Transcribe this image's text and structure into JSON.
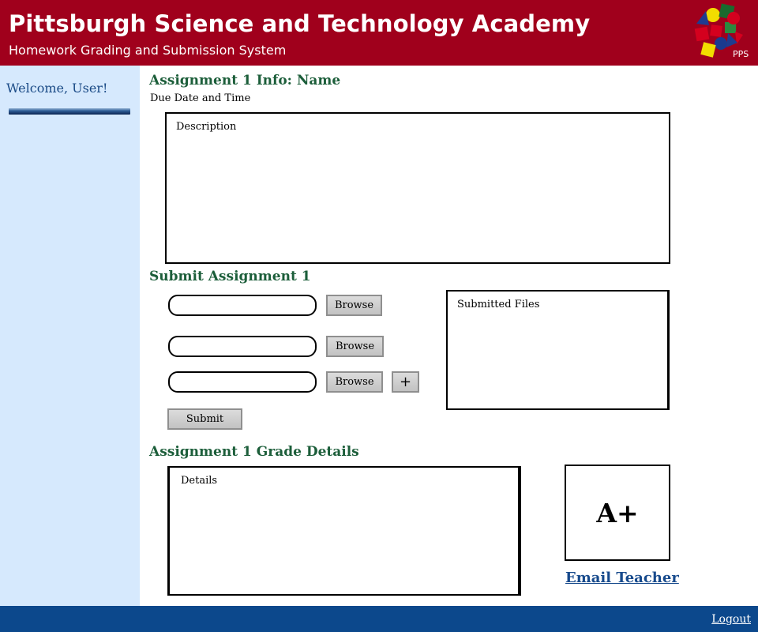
{
  "header": {
    "title": "Pittsburgh Science and Technology Academy",
    "subtitle": "Homework Grading and Submission System",
    "logo_text": "PPS"
  },
  "sidebar": {
    "welcome": "Welcome, User!"
  },
  "assignment_info": {
    "title": "Assignment 1 Info: Name",
    "due": "Due Date and Time",
    "description_label": "Description"
  },
  "submit": {
    "title": "Submit Assignment 1",
    "browse_labels": [
      "Browse",
      "Browse",
      "Browse"
    ],
    "add_label": "+",
    "submit_label": "Submit",
    "submitted_files_label": "Submitted Files"
  },
  "grade": {
    "title": "Assignment 1 Grade Details",
    "details_label": "Details",
    "value": "A+",
    "email_label": "Email Teacher"
  },
  "footer": {
    "logout_label": "Logout"
  },
  "colors": {
    "header_bg": "#a0001c",
    "sidebar_bg": "#d6e9fd",
    "footer_bg": "#0c488c",
    "section_title": "#1c5e3a",
    "link": "#174a8c"
  }
}
